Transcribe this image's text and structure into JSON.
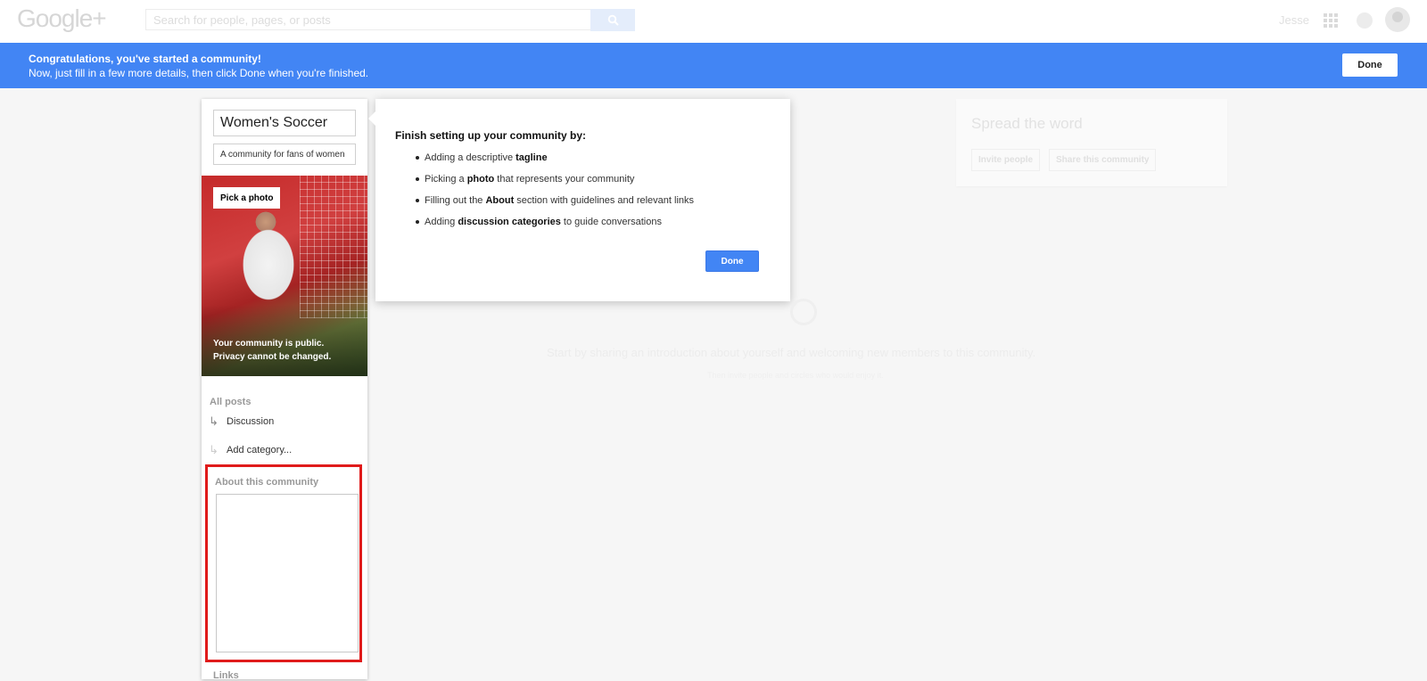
{
  "topbar": {
    "logo": "Google+",
    "search_placeholder": "Search for people, pages, or posts",
    "user_name": "Jesse"
  },
  "banner": {
    "title": "Congratulations, you've started a community!",
    "subtitle": "Now, just fill in a few more details, then click Done when you're finished.",
    "done_label": "Done",
    "color": "#4285f4"
  },
  "community": {
    "name": "Women's Soccer",
    "tagline": "A community for fans of women",
    "pick_photo_label": "Pick a photo",
    "privacy_line1": "Your community is public.",
    "privacy_line2": "Privacy cannot be changed.",
    "all_posts_label": "All posts",
    "categories": [
      "Discussion",
      "Add category..."
    ],
    "about_label": "About this community",
    "about_value": "",
    "links_label": "Links"
  },
  "popup": {
    "title": "Finish setting up your community by:",
    "items": [
      {
        "pre": "Adding a descriptive ",
        "bold": "tagline",
        "post": ""
      },
      {
        "pre": "Picking a ",
        "bold": "photo",
        "post": " that represents your community"
      },
      {
        "pre": "Filling out the ",
        "bold": "About",
        "post": " section with guidelines and relevant links"
      },
      {
        "pre": "Adding ",
        "bold": "discussion categories",
        "post": " to guide conversations"
      }
    ],
    "done_label": "Done"
  },
  "spread": {
    "title": "Spread the word",
    "invite_label": "Invite people",
    "share_label": "Share this community"
  },
  "empty_state": {
    "main": "Start by sharing an introduction about yourself and welcoming new members to this community.",
    "sub": "Then invite people and circles who would enjoy it."
  },
  "icons": [
    "search-icon",
    "apps-icon",
    "notifications-icon",
    "avatar",
    "reply-arrow-icon",
    "resize-grip-icon"
  ],
  "highlight_color": "#e01b1b"
}
